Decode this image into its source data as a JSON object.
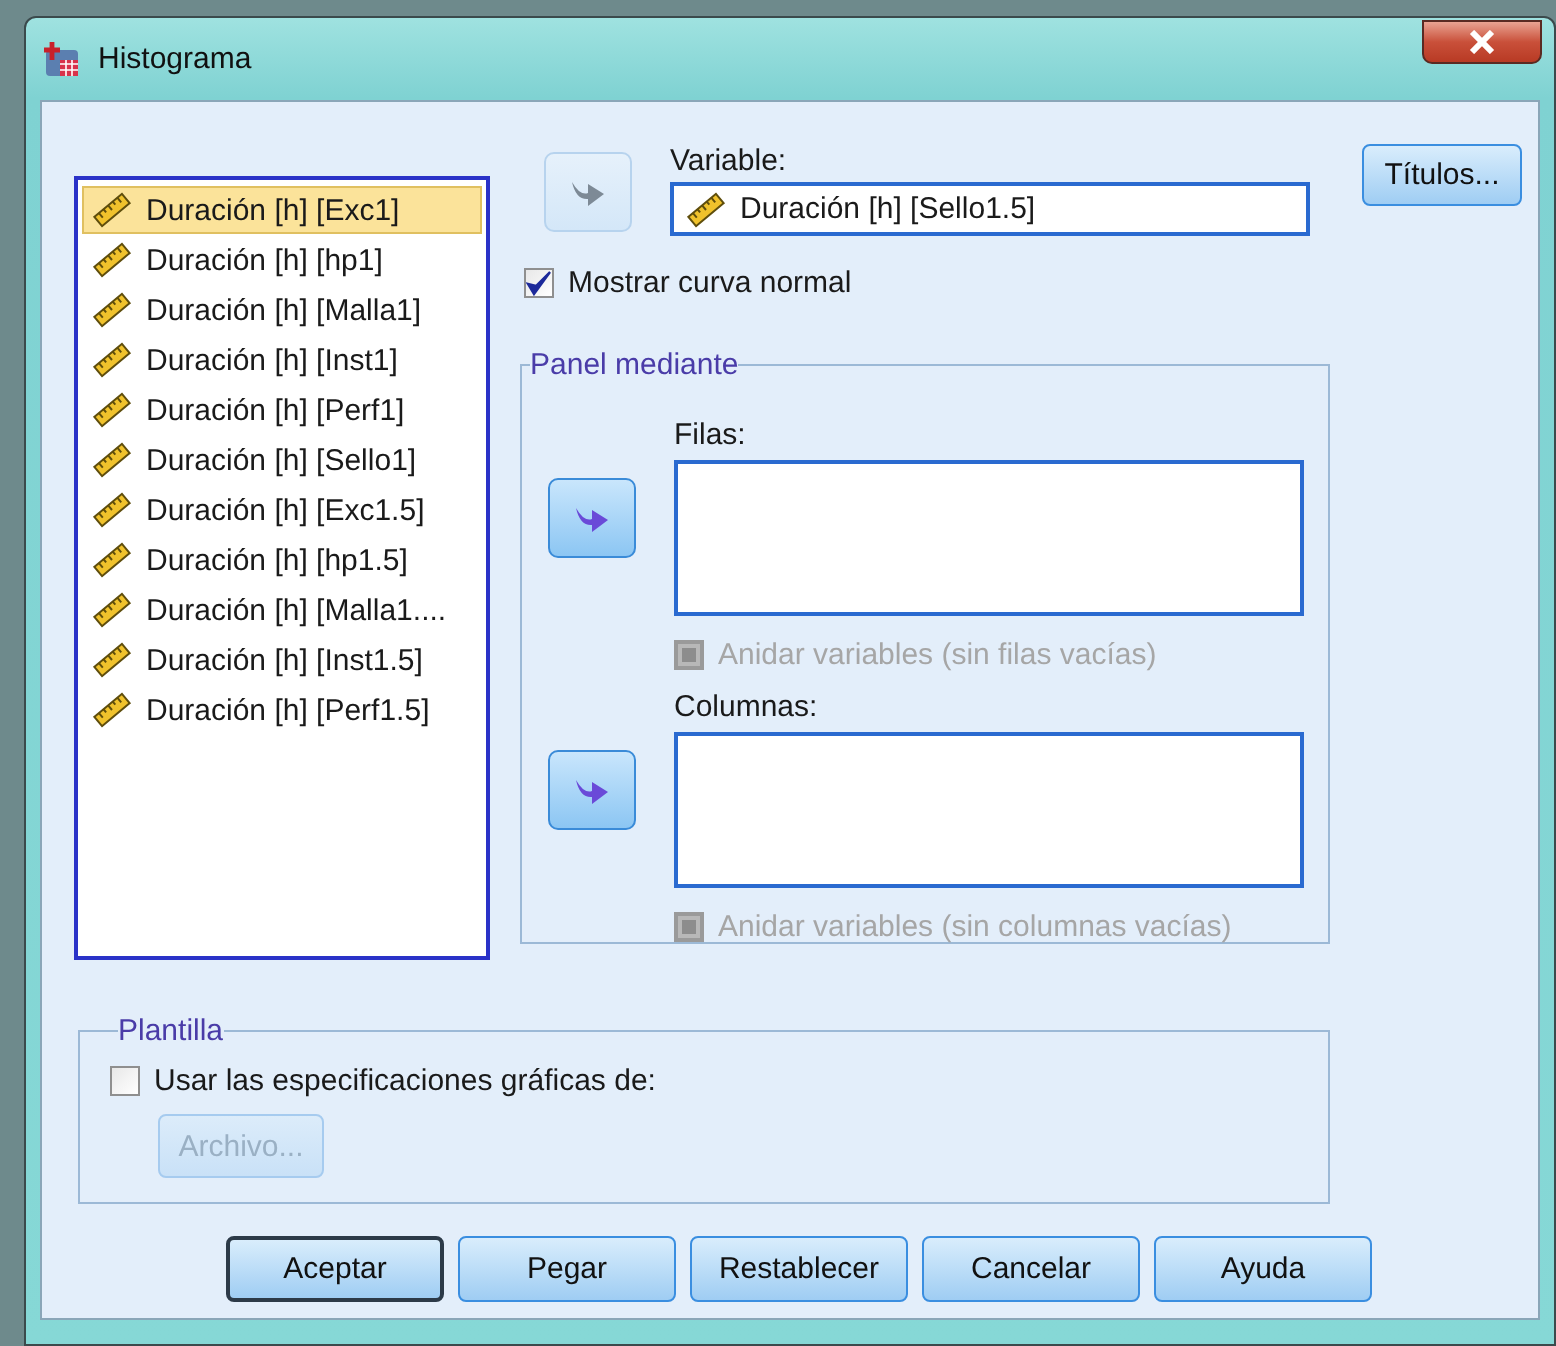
{
  "window": {
    "title": "Histograma"
  },
  "variables": [
    {
      "label": "Duración [h] [Exc1]",
      "selected": true
    },
    {
      "label": "Duración [h] [hp1]",
      "selected": false
    },
    {
      "label": "Duración [h] [Malla1]",
      "selected": false
    },
    {
      "label": "Duración [h] [Inst1]",
      "selected": false
    },
    {
      "label": "Duración [h] [Perf1]",
      "selected": false
    },
    {
      "label": "Duración [h] [Sello1]",
      "selected": false
    },
    {
      "label": "Duración [h] [Exc1.5]",
      "selected": false
    },
    {
      "label": "Duración [h] [hp1.5]",
      "selected": false
    },
    {
      "label": "Duración [h] [Malla1....",
      "selected": false
    },
    {
      "label": "Duración [h] [Inst1.5]",
      "selected": false
    },
    {
      "label": "Duración [h] [Perf1.5]",
      "selected": false
    }
  ],
  "variable": {
    "label": "Variable:",
    "value": "Duración [h] [Sello1.5]",
    "arrow_disabled": true
  },
  "titles_button": "Títulos...",
  "normal_curve": {
    "label": "Mostrar curva normal",
    "checked": true
  },
  "panel": {
    "title": "Panel mediante",
    "rows": {
      "label": "Filas:",
      "arrow_disabled": false,
      "nest": {
        "label": "Anidar variables (sin filas vacías)",
        "checked": false,
        "disabled": true
      }
    },
    "columns": {
      "label": "Columnas:",
      "arrow_disabled": false,
      "nest": {
        "label": "Anidar variables (sin columnas vacías)",
        "checked": false,
        "disabled": true
      }
    }
  },
  "template": {
    "title": "Plantilla",
    "use": {
      "label": "Usar las especificaciones gráficas de:",
      "checked": false,
      "disabled": false
    },
    "file_button": {
      "label": "Archivo...",
      "disabled": true
    }
  },
  "buttons": [
    {
      "label": "Aceptar",
      "default": true
    },
    {
      "label": "Pegar",
      "default": false
    },
    {
      "label": "Restablecer",
      "default": false
    },
    {
      "label": "Cancelar",
      "default": false
    },
    {
      "label": "Ayuda",
      "default": false
    }
  ]
}
